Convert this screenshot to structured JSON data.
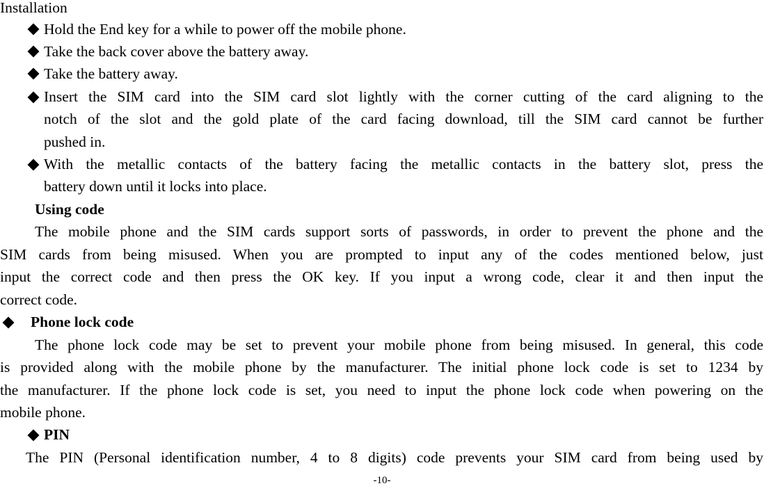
{
  "document": {
    "section_title": "Installation",
    "installation_steps": [
      {
        "lines": [
          "Hold the End key for a while to power off the mobile phone."
        ]
      },
      {
        "lines": [
          "Take the back cover above the battery away."
        ]
      },
      {
        "lines": [
          "Take the battery away."
        ]
      },
      {
        "lines": [
          "Insert the SIM card into the SIM card slot lightly with the corner cutting of the card aligning to the",
          "notch of the slot and the gold plate of the card facing download, till the SIM card cannot be further",
          "pushed in."
        ]
      },
      {
        "lines": [
          "With the metallic contacts of the battery facing the metallic contacts in the battery slot, press the",
          "battery down until it locks into place."
        ]
      }
    ],
    "using_code": {
      "heading": "Using code",
      "paragraph_lines": [
        "The mobile phone and the SIM cards support sorts of passwords, in order to prevent the phone and the",
        "SIM cards from being misused. When you are prompted to input any of the codes mentioned below, just",
        "input the correct code and then press the OK key. If you input a wrong code, clear it and then input the",
        "correct code."
      ]
    },
    "phone_lock_code": {
      "heading": "Phone lock code",
      "paragraph_lines": [
        "The phone lock code may be set to prevent your mobile phone from being misused. In general, this code",
        "is provided along with the mobile phone by the manufacturer. The initial phone lock code is set to 1234 by",
        "the manufacturer. If the phone lock code is set, you need to input the phone lock code when powering on the",
        "mobile phone."
      ]
    },
    "pin": {
      "heading": "PIN",
      "paragraph_lines": [
        "The PIN (Personal identification number, 4 to 8 digits) code prevents your SIM card from being used by"
      ]
    },
    "page_number": "-10-"
  }
}
